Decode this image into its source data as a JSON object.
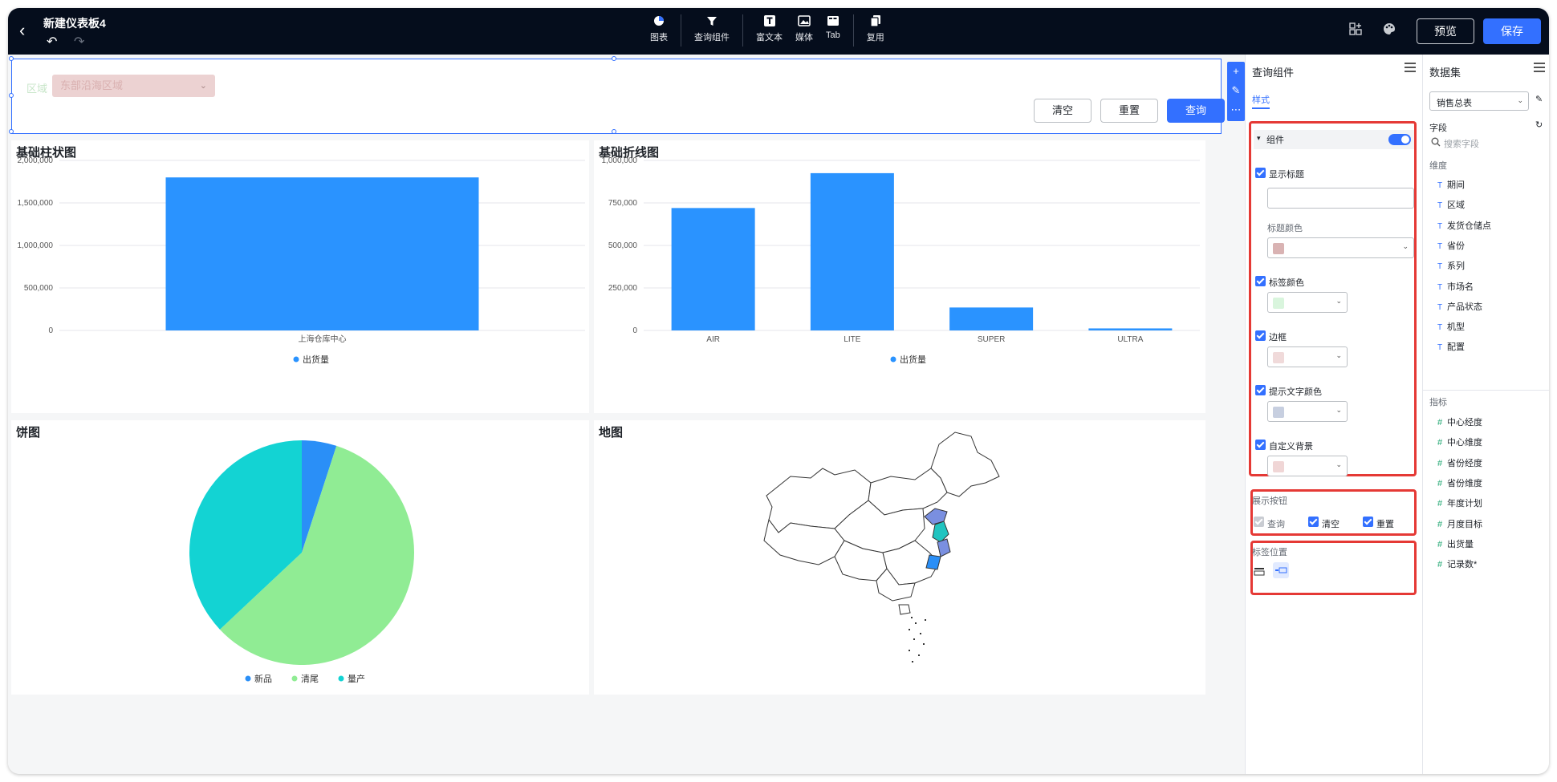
{
  "header": {
    "title": "新建仪表板4",
    "tools": [
      {
        "label": "图表",
        "icon": "pie-chart-icon"
      },
      {
        "label": "查询组件",
        "icon": "filter-icon"
      },
      {
        "label": "富文本",
        "icon": "text-icon"
      },
      {
        "label": "媒体",
        "icon": "image-icon"
      },
      {
        "label": "Tab",
        "icon": "tab-icon"
      },
      {
        "label": "复用",
        "icon": "copy-icon"
      }
    ],
    "preview_label": "预览",
    "save_label": "保存"
  },
  "query": {
    "field_label": "区域",
    "select_placeholder": "东部沿海区域",
    "clear_label": "清空",
    "reset_label": "重置",
    "query_label": "查询"
  },
  "bar_chart": {
    "title": "基础柱状图",
    "chart_data": {
      "type": "bar",
      "categories": [
        "上海仓库中心"
      ],
      "series": [
        {
          "name": "出货量",
          "values": [
            1800000
          ]
        }
      ],
      "ylim": [
        0,
        2000000
      ],
      "yticks": [
        "0",
        "500,000",
        "1,000,000",
        "1,500,000",
        "2,000,000"
      ],
      "legend": "bottom"
    }
  },
  "line_chart": {
    "title": "基础折线图",
    "chart_data": {
      "type": "bar",
      "categories": [
        "AIR",
        "LITE",
        "SUPER",
        "ULTRA"
      ],
      "series": [
        {
          "name": "出货量",
          "values": [
            720000,
            925000,
            135000,
            12000
          ]
        }
      ],
      "ylim": [
        0,
        1000000
      ],
      "yticks": [
        "0",
        "250,000",
        "500,000",
        "750,000",
        "1,000,000"
      ],
      "legend": "bottom"
    }
  },
  "pie_chart": {
    "title": "饼图",
    "chart_data": {
      "type": "pie",
      "categories": [
        "新品",
        "清尾",
        "量产"
      ],
      "values": [
        5,
        58,
        37
      ],
      "colors": [
        "#2a8ff7",
        "#90ec94",
        "#13d3d3"
      ],
      "legend": "bottom"
    }
  },
  "map": {
    "title": "地图"
  },
  "colors": {
    "accent": "#3370ff",
    "bar": "#2a93ff",
    "map_blue1": "#7a8fe0",
    "map_teal": "#21c4c0",
    "map_blue2": "#2a8ff7"
  },
  "query_panel": {
    "title": "查询组件",
    "tab_label": "样式",
    "section_label": "组件",
    "show_title_label": "显示标题",
    "title_color_label": "标题颜色",
    "label_color_label": "标签颜色",
    "border_label": "边框",
    "hint_color_label": "提示文字颜色",
    "custom_bg_label": "自定义背景",
    "show_buttons_label": "展示按钮",
    "btn_query": "查询",
    "btn_clear": "清空",
    "btn_reset": "重置",
    "label_position_label": "标签位置",
    "swatches": {
      "title": "#d9b3b3",
      "label": "#d9f5dd",
      "border": "#f0dada",
      "hint": "#c7cfe0",
      "bg": "#f0d6d6"
    }
  },
  "dataset_panel": {
    "title": "数据集",
    "dataset_value": "销售总表",
    "fields_label": "字段",
    "search_placeholder": "搜索字段",
    "dimension_label": "维度",
    "dimensions": [
      "期间",
      "区域",
      "发货仓储点",
      "省份",
      "系列",
      "市场名",
      "产品状态",
      "机型",
      "配置"
    ],
    "metric_label": "指标",
    "metrics": [
      "中心经度",
      "中心维度",
      "省份经度",
      "省份维度",
      "年度计划",
      "月度目标",
      "出货量",
      "记录数*"
    ]
  }
}
